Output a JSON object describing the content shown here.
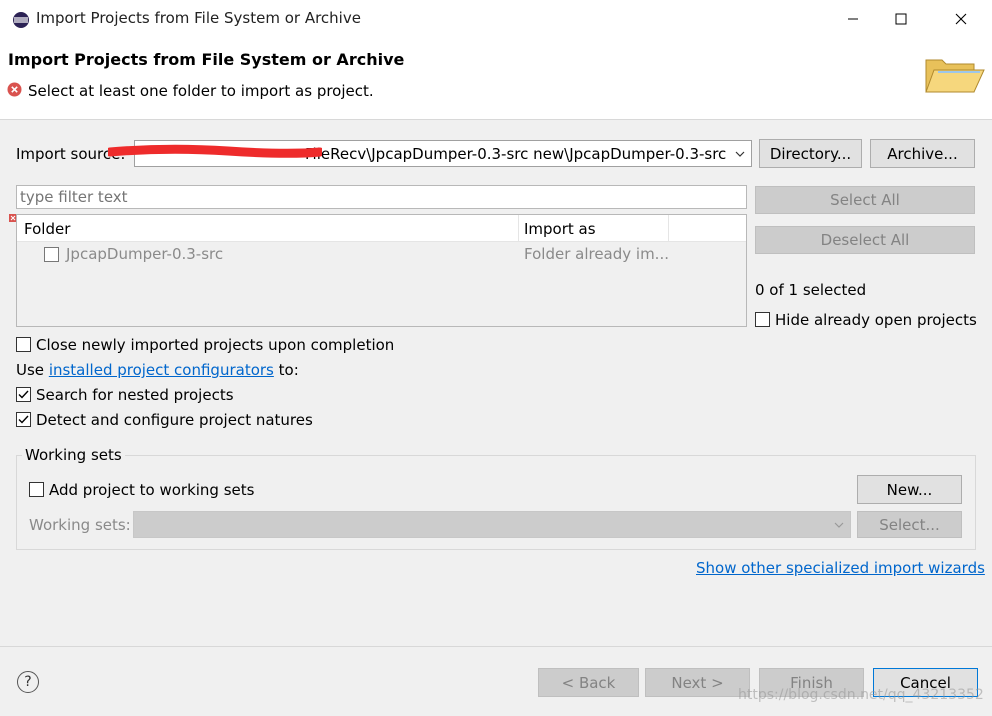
{
  "window": {
    "title": "Import Projects from File System or Archive",
    "minimize_glyph": "—",
    "maximize_glyph": "☐",
    "close_glyph": "✕"
  },
  "banner": {
    "title": "Import Projects from File System or Archive",
    "message": "Select at least one folder to import as project.",
    "icon": "folder-open-icon"
  },
  "import_source": {
    "label": "Import source:",
    "value": "FileRecv\\JpcapDumper-0.3-src new\\JpcapDumper-0.3-src",
    "directory_button": "Directory...",
    "archive_button": "Archive..."
  },
  "filter": {
    "placeholder": "type filter text"
  },
  "table": {
    "columns": [
      "Folder",
      "Import as"
    ],
    "rows": [
      {
        "folder": "JpcapDumper-0.3-src",
        "import_as": "Folder already im..."
      }
    ]
  },
  "side": {
    "select_all": "Select All",
    "deselect_all": "Deselect All",
    "selected_count": "0 of 1 selected",
    "hide_open": "Hide already open projects"
  },
  "options": {
    "close_imported": "Close newly imported projects upon completion",
    "use_prefix": "Use",
    "configurators_link": "installed project configurators",
    "use_suffix": "to:",
    "nested": "Search for nested projects",
    "natures": "Detect and configure project natures"
  },
  "working_sets": {
    "group_label": "Working sets",
    "add_label": "Add project to working sets",
    "new_button": "New...",
    "sets_label": "Working sets:",
    "select_button": "Select..."
  },
  "other_wizards_link": "Show other specialized import wizards",
  "footer": {
    "help_glyph": "?",
    "back": "< Back",
    "next": "Next >",
    "finish": "Finish",
    "cancel": "Cancel",
    "watermark": "https://blog.csdn.net/qq_43213352"
  },
  "colors": {
    "accent": "#0078d7",
    "link": "#0066cc",
    "error": "#d9534f",
    "redaction": "#ee2b2b"
  }
}
